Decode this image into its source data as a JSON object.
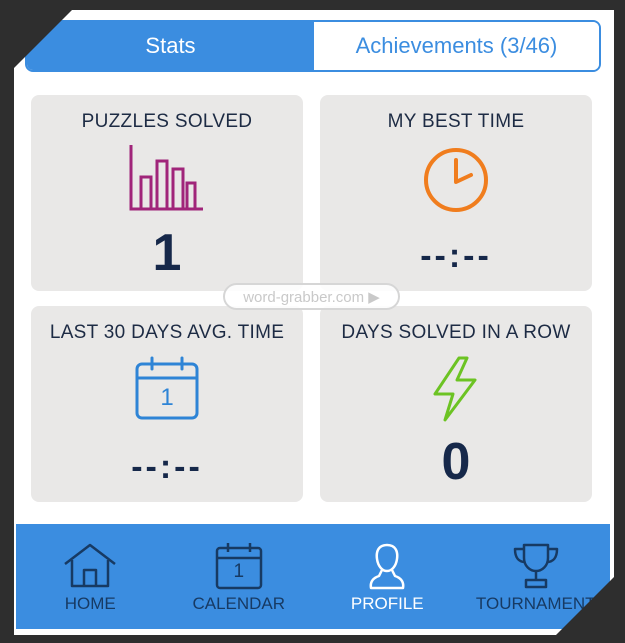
{
  "tabs": {
    "stats": "Stats",
    "achievements": "Achievements (3/46)"
  },
  "cards": [
    {
      "title": "PUZZLES SOLVED",
      "value": "1"
    },
    {
      "title": "MY BEST TIME",
      "value": "--:--"
    },
    {
      "title": "LAST 30 DAYS AVG. TIME",
      "value": "--:--",
      "calendar_day": "1"
    },
    {
      "title": "DAYS SOLVED IN A ROW",
      "value": "0"
    }
  ],
  "watermark": "word-grabber.com ▶",
  "nav": [
    {
      "label": "HOME",
      "icon": "home-icon"
    },
    {
      "label": "CALENDAR",
      "icon": "calendar-icon",
      "day": "1"
    },
    {
      "label": "PROFILE",
      "icon": "profile-icon",
      "active": true
    },
    {
      "label": "TOURNAMENT",
      "icon": "trophy-icon"
    }
  ],
  "colors": {
    "accent": "#3b8de0",
    "card": "#e9e8e7",
    "text_dark": "#16284a",
    "chart_icon": "#a0257a",
    "clock_icon": "#f07d1e",
    "calendar_icon": "#2e84d6",
    "bolt_icon": "#6cc323"
  }
}
